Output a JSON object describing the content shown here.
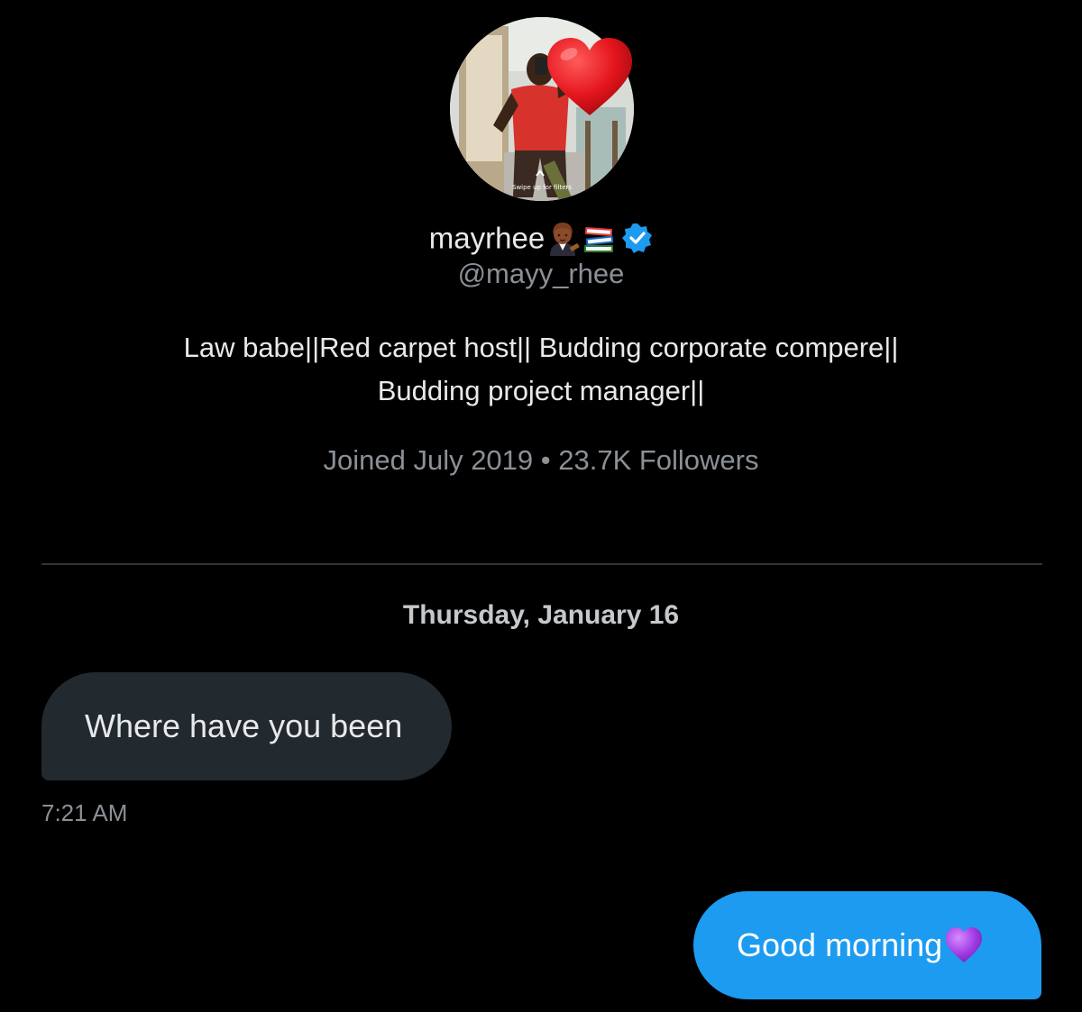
{
  "profile": {
    "display_name": "mayrhee",
    "name_emojis": [
      "woman-judge-emoji",
      "books-emoji"
    ],
    "verified_icon": "verified-badge-icon",
    "handle": "@mayy_rhee",
    "bio_lines": [
      "Law babe||Red carpet host|| Budding corporate compere||",
      "Budding project manager||"
    ],
    "meta": "Joined July 2019 • 23.7K Followers",
    "avatar_caption": "Swipe up for filters"
  },
  "conversation": {
    "date_separator": "Thursday, January 16",
    "messages": [
      {
        "direction": "received",
        "text": "Where have you been",
        "timestamp": "7:21 AM"
      },
      {
        "direction": "sent",
        "text": "Good morning",
        "emoji": "purple-heart-emoji"
      }
    ]
  },
  "colors": {
    "background": "#000000",
    "primary_text": "#e7e9ea",
    "secondary_text": "#8b9096",
    "received_bubble": "#22292f",
    "sent_bubble": "#1d9bf0",
    "verified_blue": "#1d9bf0",
    "divider": "#2f3336"
  }
}
